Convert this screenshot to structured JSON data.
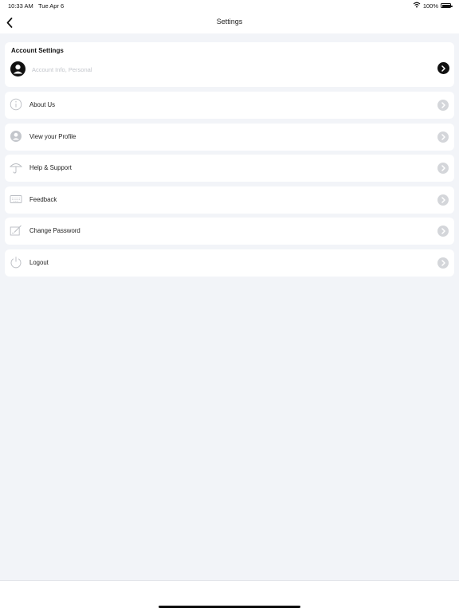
{
  "status_bar": {
    "time": "10:33 AM",
    "date": "Tue Apr 6",
    "battery": "100%"
  },
  "nav": {
    "title": "Settings"
  },
  "account": {
    "title": "Account Settings",
    "subtitle": "Account Info, Personal"
  },
  "items": [
    {
      "label": "About Us",
      "icon": "info-icon"
    },
    {
      "label": "View your Profile",
      "icon": "profile-icon"
    },
    {
      "label": "Help & Support",
      "icon": "umbrella-icon"
    },
    {
      "label": "Feedback",
      "icon": "keyboard-icon"
    },
    {
      "label": "Change Password",
      "icon": "edit-icon"
    },
    {
      "label": "Logout",
      "icon": "power-icon"
    }
  ],
  "colors": {
    "background": "#f2f4f8",
    "card": "#ffffff",
    "chevron_light": "#d4d6da",
    "chevron_dark": "#111111"
  }
}
